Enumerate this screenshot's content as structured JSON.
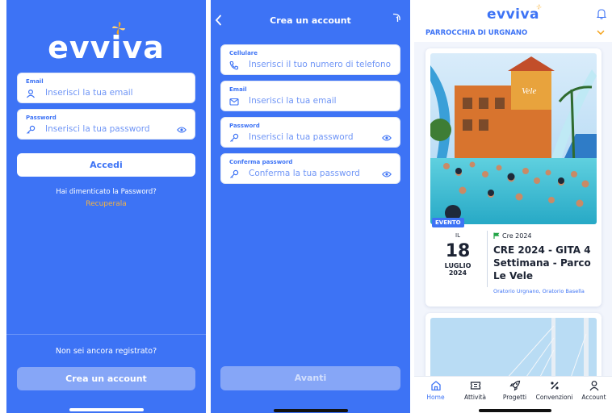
{
  "brand": {
    "name": "evviva",
    "blue": "#3D73F5",
    "accent": "#F5A623"
  },
  "login": {
    "email": {
      "label": "Email",
      "placeholder": "Inserisci la tua email",
      "icon": "user-icon"
    },
    "password": {
      "label": "Password",
      "placeholder": "Inserisci la tua password",
      "icon": "key-icon"
    },
    "login_button": "Accedi",
    "forgot_text": "Hai dimenticato la Password?",
    "recover_link": "Recuperala",
    "not_registered": "Non sei ancora registrato?",
    "create_account_button": "Crea un account"
  },
  "register": {
    "title": "Crea un account",
    "phone": {
      "label": "Cellulare",
      "placeholder": "Inserisci il tuo numero di telefono",
      "icon": "phone-icon"
    },
    "email": {
      "label": "Email",
      "placeholder": "Inserisci la tua email",
      "icon": "mail-icon"
    },
    "password": {
      "label": "Password",
      "placeholder": "Inserisci la tua password",
      "icon": "key-icon"
    },
    "confirm": {
      "label": "Conferma password",
      "placeholder": "Conferma la tua password",
      "icon": "key-icon"
    },
    "next_button": "Avanti"
  },
  "feed": {
    "parish": "PARROCCHIA DI URGNANO",
    "event": {
      "tag": "EVENTO",
      "date_prefix": "IL",
      "day": "18",
      "month": "LUGLIO",
      "year": "2024",
      "category": "Cre 2024",
      "title": "CRE 2024 - GITA 4 Settimana - Parco Le Vele",
      "organizers": "Oratorio Urgnano, Oratorio Basella",
      "photo_sign": "Vele"
    },
    "tabs": [
      {
        "label": "Home",
        "icon": "home-icon"
      },
      {
        "label": "Attività",
        "icon": "ticket-icon"
      },
      {
        "label": "Progetti",
        "icon": "rocket-icon"
      },
      {
        "label": "Convenzioni",
        "icon": "percent-icon"
      },
      {
        "label": "Account",
        "icon": "user-icon"
      }
    ]
  }
}
